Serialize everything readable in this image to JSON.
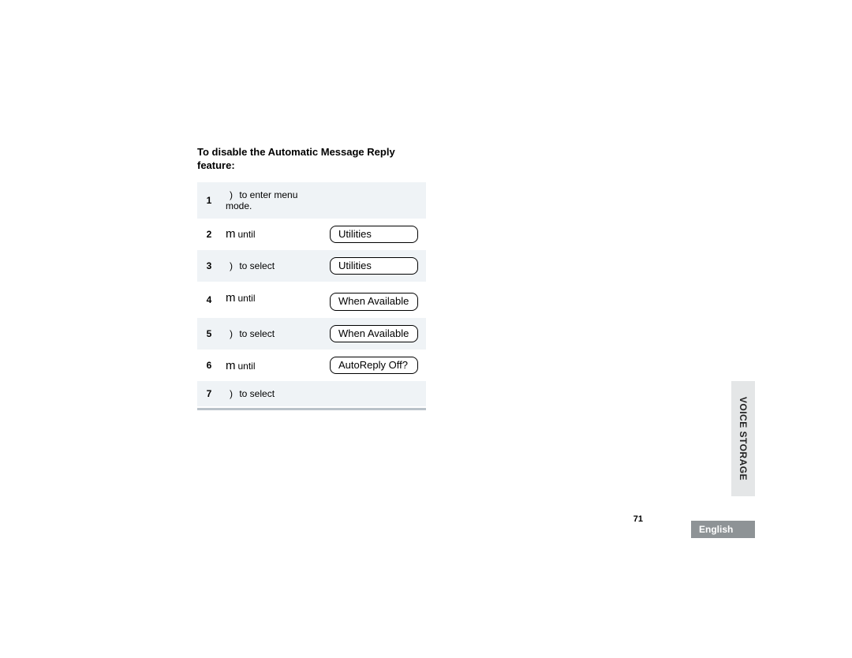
{
  "heading_line1": "To disable the Automatic Message Reply",
  "heading_line2": "feature:",
  "steps": {
    "r1_num": "1",
    "r1_paren": ")",
    "r1_text": "to enter menu mode.",
    "r2_num": "2",
    "r2_icon": "m",
    "r2_until": "until",
    "r2_disp": "Utilities",
    "r3_num": "3",
    "r3_paren": ")",
    "r3_text": "to select",
    "r3_disp": "Utilities",
    "r4_num": "4",
    "r4_icon": "m",
    "r4_until": "until",
    "r4_disp": "When Available",
    "r5_num": "5",
    "r5_paren": ")",
    "r5_text": "to select",
    "r5_disp": "When Available",
    "r6_num": "6",
    "r6_icon": "m",
    "r6_until": "until",
    "r6_disp": "AutoReply Off?",
    "r7_num": "7",
    "r7_paren": ")",
    "r7_text": "to select"
  },
  "side_tab": "VOICE STORAGE",
  "page_number": "71",
  "language": "English"
}
